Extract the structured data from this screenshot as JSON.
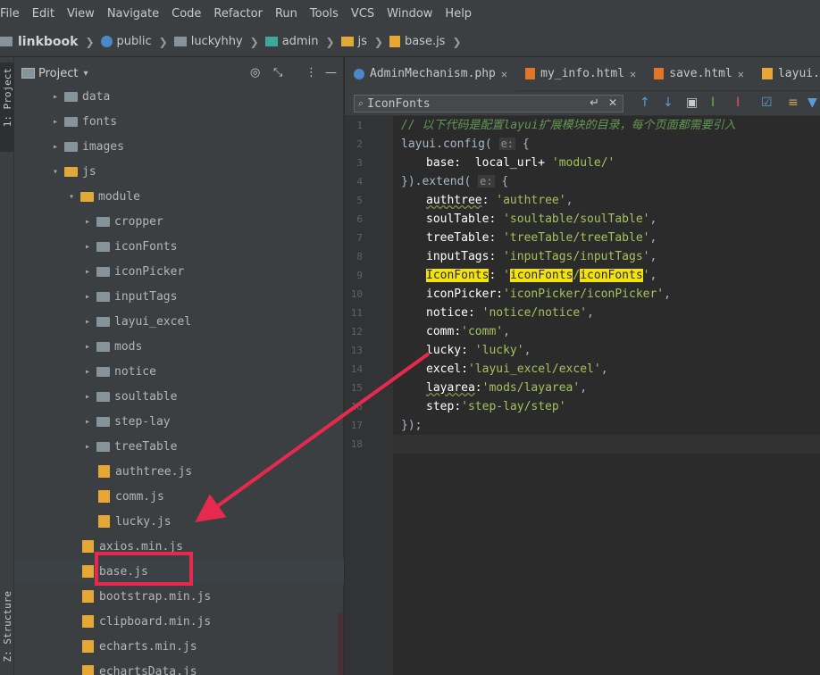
{
  "menu": [
    "File",
    "Edit",
    "View",
    "Navigate",
    "Code",
    "Refactor",
    "Run",
    "Tools",
    "VCS",
    "Window",
    "Help"
  ],
  "breadcrumb": [
    "linkbook",
    "public",
    "luckyhhy",
    "admin",
    "js",
    "base.js"
  ],
  "project_panel": {
    "title": "Project",
    "tree": [
      {
        "label": "data",
        "kind": "folder"
      },
      {
        "label": "fonts",
        "kind": "folder"
      },
      {
        "label": "images",
        "kind": "folder"
      },
      {
        "label": "js",
        "kind": "folder-open"
      },
      {
        "label": "module",
        "kind": "folder-open"
      },
      {
        "label": "cropper",
        "kind": "folder"
      },
      {
        "label": "iconFonts",
        "kind": "folder"
      },
      {
        "label": "iconPicker",
        "kind": "folder"
      },
      {
        "label": "inputTags",
        "kind": "folder"
      },
      {
        "label": "layui_excel",
        "kind": "folder"
      },
      {
        "label": "mods",
        "kind": "folder"
      },
      {
        "label": "notice",
        "kind": "folder"
      },
      {
        "label": "soultable",
        "kind": "folder"
      },
      {
        "label": "step-lay",
        "kind": "folder"
      },
      {
        "label": "treeTable",
        "kind": "folder"
      },
      {
        "label": "authtree.js",
        "kind": "js"
      },
      {
        "label": "comm.js",
        "kind": "js"
      },
      {
        "label": "lucky.js",
        "kind": "js"
      },
      {
        "label": "axios.min.js",
        "kind": "js"
      },
      {
        "label": "base.js",
        "kind": "js",
        "selected": true
      },
      {
        "label": "bootstrap.min.js",
        "kind": "js"
      },
      {
        "label": "clipboard.min.js",
        "kind": "js"
      },
      {
        "label": "echarts.min.js",
        "kind": "js"
      },
      {
        "label": "echartsData.js",
        "kind": "js"
      }
    ]
  },
  "side_tabs": {
    "project": "1: Project",
    "structure": "Z: Structure"
  },
  "tabs": [
    {
      "label": "AdminMechanism.php"
    },
    {
      "label": "my_info.html"
    },
    {
      "label": "save.html"
    },
    {
      "label": "layui.js"
    }
  ],
  "search": {
    "value": "IconFonts"
  },
  "editor": {
    "line_numbers": [
      "1",
      "2",
      "3",
      "4",
      "5",
      "6",
      "7",
      "8",
      "9",
      "10",
      "11",
      "12",
      "13",
      "14",
      "15",
      "16",
      "17",
      "18"
    ],
    "comment": "// 以下代码是配置layui扩展模块的目录，每个页面都需要引入",
    "config_fn": "layui.config(",
    "param_hint": "e:",
    "base_key": "base:",
    "base_value": "local_url+",
    "base_str": "'module/'",
    "extend_fn": "}).extend(",
    "close_line": "});",
    "entries": [
      {
        "key": "authtree",
        "sep": ": ",
        "value": "'authtree'"
      },
      {
        "key": "soulTable",
        "sep": ": ",
        "value": "'soultable/soulTable'"
      },
      {
        "key": "treeTable",
        "sep": ": ",
        "value": "'treeTable/treeTable'"
      },
      {
        "key": "inputTags",
        "sep": ": ",
        "value": "'inputTags/inputTags'"
      },
      {
        "key": "IconFonts",
        "sep": ": ",
        "value": "'iconFonts/iconFonts'"
      },
      {
        "key": "iconPicker",
        "sep": ":",
        "value": "'iconPicker/iconPicker'"
      },
      {
        "key": "notice",
        "sep": ": ",
        "value": "'notice/notice'"
      },
      {
        "key": "comm",
        "sep": ":",
        "value": "'comm'"
      },
      {
        "key": "lucky",
        "sep": ": ",
        "value": "'lucky'"
      },
      {
        "key": "excel",
        "sep": ":",
        "value": "'layui_excel/excel'"
      },
      {
        "key": "layarea",
        "sep": ":",
        "value": "'mods/layarea'"
      },
      {
        "key": "step",
        "sep": ":",
        "value": "'step-lay/step'"
      }
    ]
  },
  "colors": {
    "annotation": "#e8294f",
    "search_highlight": "#f2e20f"
  }
}
